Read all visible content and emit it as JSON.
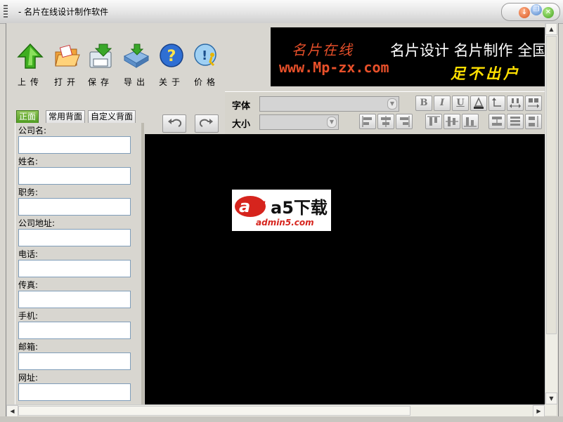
{
  "window": {
    "title": "- 名片在线设计制作软件",
    "min_symbol": "↓",
    "restore_symbol": "❐",
    "close_symbol": "✕"
  },
  "toolbar": {
    "items": [
      {
        "key": "upload",
        "label": "上传",
        "icon": "green-up-arrow-icon"
      },
      {
        "key": "open",
        "label": "打开",
        "icon": "open-folder-icon"
      },
      {
        "key": "save",
        "label": "保存",
        "icon": "save-disk-icon"
      },
      {
        "key": "export",
        "label": "导出",
        "icon": "export-icon"
      },
      {
        "key": "about",
        "label": "关于",
        "icon": "question-icon"
      },
      {
        "key": "price",
        "label": "价格",
        "icon": "price-runner-icon"
      }
    ]
  },
  "banner": {
    "brand": "名片在线",
    "slogan": "名片设计 名片制作 全国",
    "url": "www.Mp-zx.com",
    "tagline": "足不出户"
  },
  "font_panel": {
    "font_label": "字体",
    "size_label": "大小",
    "bold": "B",
    "italic": "I",
    "underline": "U",
    "font_value": "",
    "size_value": ""
  },
  "tabs": [
    {
      "label": "正面",
      "active": true
    },
    {
      "label": "常用背面",
      "active": false
    },
    {
      "label": "自定义背面",
      "active": false
    }
  ],
  "fields": [
    {
      "label": "公司名:",
      "value": ""
    },
    {
      "label": "姓名:",
      "value": ""
    },
    {
      "label": "职务:",
      "value": ""
    },
    {
      "label": "公司地址:",
      "value": ""
    },
    {
      "label": "电话:",
      "value": ""
    },
    {
      "label": "传真:",
      "value": ""
    },
    {
      "label": "手机:",
      "value": ""
    },
    {
      "label": "邮箱:",
      "value": ""
    },
    {
      "label": "网址:",
      "value": ""
    }
  ],
  "watermark": {
    "text": "a5下载",
    "url": "admin5.com"
  },
  "colors": {
    "canvas": "#000000",
    "banner_brand": "#e8502a",
    "banner_tagline": "#ffe000",
    "tab_active": "#4f9c21"
  }
}
